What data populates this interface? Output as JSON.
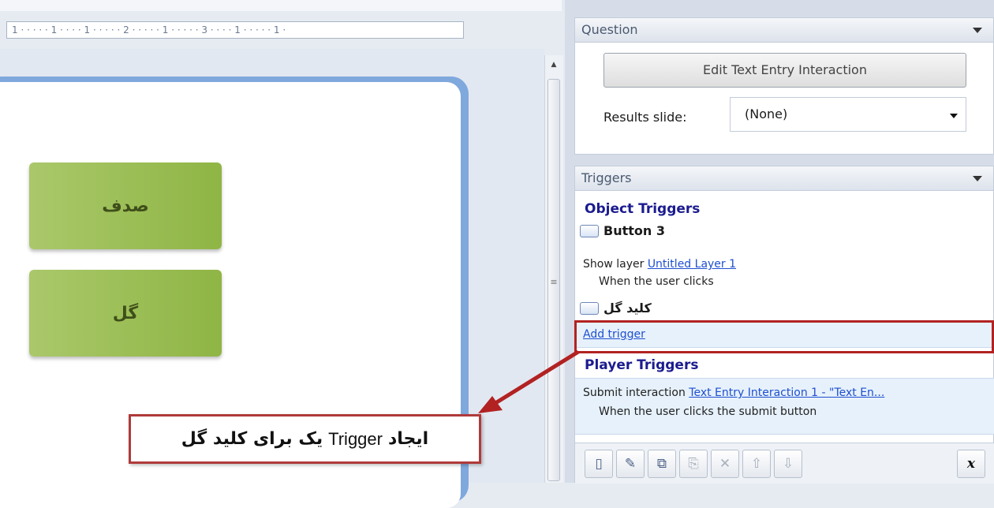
{
  "ruler": {
    "text": "1 · · · · · 1 · · · · 1 · · · · · 2 · · · · · 1 · · · · · 3 · · · · 1 · · · · · 1 ·"
  },
  "slide": {
    "buttons": [
      {
        "label": "صدف"
      },
      {
        "label": "گل"
      }
    ]
  },
  "question_panel": {
    "title": "Question",
    "edit_button": "Edit Text Entry Interaction",
    "results_label": "Results slide:",
    "results_value": "(None)"
  },
  "triggers_panel": {
    "title": "Triggers",
    "object_triggers_title": "Object Triggers",
    "button3_name": "Button 3",
    "show_layer_prefix": "Show layer",
    "show_layer_link": "Untitled Layer 1",
    "when_clicks": "When the user clicks",
    "key_gol_name": "کلید گل",
    "add_trigger": "Add trigger",
    "player_triggers_title": "Player Triggers",
    "submit_prefix": "Submit interaction",
    "submit_link": "Text Entry Interaction 1 - \"Text En...",
    "submit_when": "When the user clicks the submit button"
  },
  "toolbar": {
    "icons": [
      "new-trigger-icon",
      "edit-trigger-icon",
      "copy-icon",
      "paste-icon",
      "delete-icon",
      "move-up-icon",
      "move-down-icon",
      "variables-icon"
    ],
    "variables_glyph": "x"
  },
  "callout": {
    "text_bold_1": "ایجاد",
    "text_normal": "Trigger",
    "text_bold_2": "یک برای کلید گل"
  },
  "colors": {
    "highlight": "#b22222",
    "link": "#1f4fd1",
    "section_title": "#1b1b8f",
    "slide_button": "#9bbd55"
  }
}
